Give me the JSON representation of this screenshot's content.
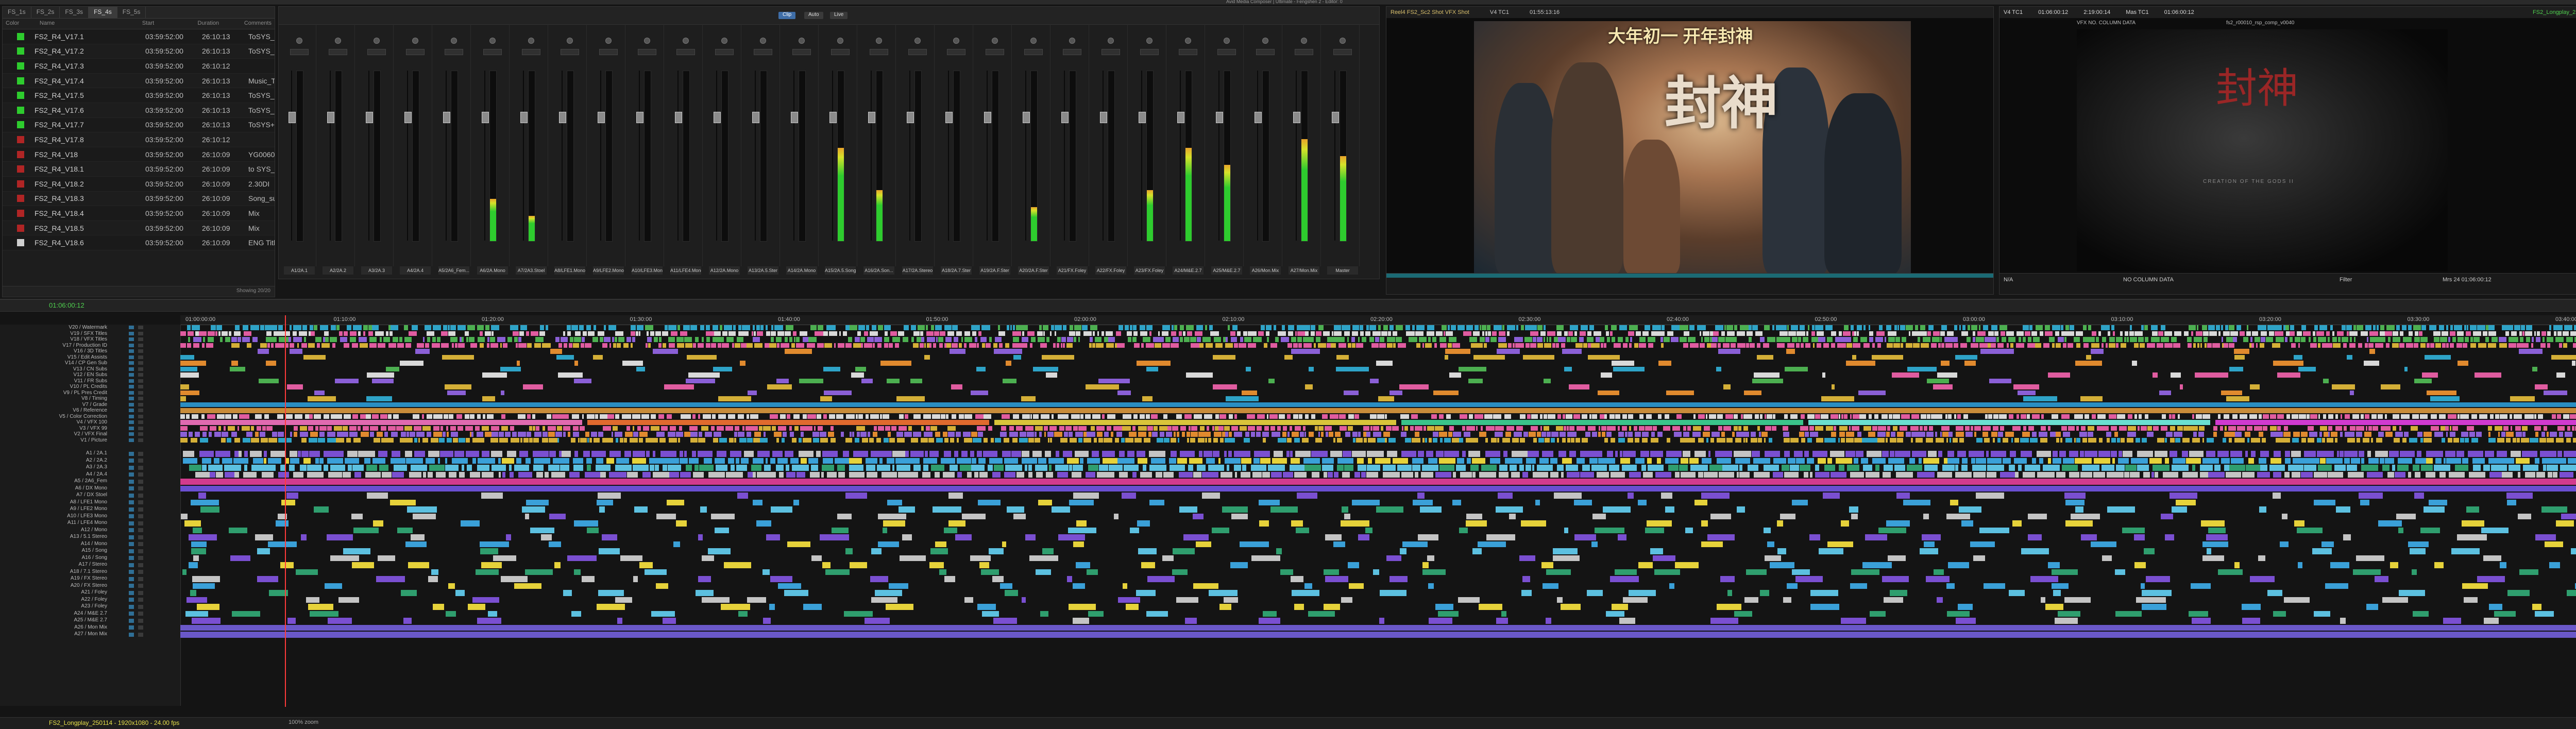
{
  "app": {
    "title": "Avid Media Composer | Ultimate - Fengshen 2 - Editor: 0"
  },
  "bin": {
    "tabs": [
      "FS_1s",
      "FS_2s",
      "FS_3s",
      "FS_4s",
      "FS_5s"
    ],
    "active_tab": 3,
    "columns": [
      "Color",
      "Name",
      "Start",
      "Duration",
      "Comments"
    ],
    "rows": [
      {
        "color": "#2ecc2e",
        "name": "FS2_R4_V17.1",
        "start": "03:59:52:00",
        "duration": "26:10:13",
        "comment": "ToSYS_241202"
      },
      {
        "color": "#2ecc2e",
        "name": "FS2_R4_V17.2",
        "start": "03:59:52:00",
        "duration": "26:10:13",
        "comment": "ToSYS_241208"
      },
      {
        "color": "#2ecc2e",
        "name": "FS2_R4_V17.3",
        "start": "03:59:52:00",
        "duration": "26:10:12",
        "comment": ""
      },
      {
        "color": "#2ecc2e",
        "name": "FS2_R4_V17.4",
        "start": "03:59:52:00",
        "duration": "26:10:13",
        "comment": "Music_ToSYS_241"
      },
      {
        "color": "#2ecc2e",
        "name": "FS2_R4_V17.5",
        "start": "03:59:52:00",
        "duration": "26:10:13",
        "comment": "ToSYS_241223"
      },
      {
        "color": "#2ecc2e",
        "name": "FS2_R4_V17.6",
        "start": "03:59:52:00",
        "duration": "26:10:13",
        "comment": "ToSYS_241225"
      },
      {
        "color": "#2ecc2e",
        "name": "FS2_R4_V17.7",
        "start": "03:59:52:00",
        "duration": "26:10:13",
        "comment": "ToSYS+DI_24125"
      },
      {
        "color": "#b02525",
        "name": "FS2_R4_V17.8",
        "start": "03:59:52:00",
        "duration": "26:10:12",
        "comment": ""
      },
      {
        "color": "#b02525",
        "name": "FS2_R4_V18",
        "start": "03:59:52:00",
        "duration": "26:10:09",
        "comment": "YG0060_ToPost_2"
      },
      {
        "color": "#b02525",
        "name": "FS2_R4_V18.1",
        "start": "03:59:52:00",
        "duration": "26:10:09",
        "comment": "to SYS_250102"
      },
      {
        "color": "#b02525",
        "name": "FS2_R4_V18.2",
        "start": "03:59:52:00",
        "duration": "26:10:09",
        "comment": "2.30DI"
      },
      {
        "color": "#b02525",
        "name": "FS2_R4_V18.3",
        "start": "03:59:52:00",
        "duration": "26:10:09",
        "comment": "Song_subs CNT"
      },
      {
        "color": "#b02525",
        "name": "FS2_R4_V18.4",
        "start": "03:59:52:00",
        "duration": "26:10:09",
        "comment": "Mix"
      },
      {
        "color": "#b02525",
        "name": "FS2_R4_V18.5",
        "start": "03:59:52:00",
        "duration": "26:10:09",
        "comment": "Mix"
      },
      {
        "color": "#cfcfcf",
        "name": "FS2_R4_V18.6",
        "start": "03:59:52:00",
        "duration": "26:10:09",
        "comment": "ENG Titles"
      }
    ],
    "footer": "Showing 20/20"
  },
  "mixer": {
    "buttons": [
      "Clip",
      "Auto",
      "Live"
    ],
    "active_button": 0,
    "strips": [
      {
        "label": "A1/2A.1",
        "level": 0
      },
      {
        "label": "A2/2A.2",
        "level": 0
      },
      {
        "label": "A3/2A.3",
        "level": 0
      },
      {
        "label": "A4/2A.4",
        "level": 0
      },
      {
        "label": "A5/2A6_Fem...",
        "level": 0
      },
      {
        "label": "A6/2A.Mono",
        "level": 0.25
      },
      {
        "label": "A7/2A3.Stoel",
        "level": 0.15
      },
      {
        "label": "A8/LFE1.Mono",
        "level": 0
      },
      {
        "label": "A9/LFE2.Mono",
        "level": 0
      },
      {
        "label": "A10/LFE3.Mono",
        "level": 0
      },
      {
        "label": "A11/LFE4.Mono",
        "level": 0
      },
      {
        "label": "A12/2A.Mono",
        "level": 0
      },
      {
        "label": "A13/2A.5.Ster",
        "level": 0
      },
      {
        "label": "A14/2A.Mono",
        "level": 0
      },
      {
        "label": "A15/2A.5.Song",
        "level": 0.55
      },
      {
        "label": "A16/2A.Son...",
        "level": 0.3
      },
      {
        "label": "A17/2A.Stereo",
        "level": 0
      },
      {
        "label": "A18/2A.7.Ster",
        "level": 0
      },
      {
        "label": "A19/2A.F.Ster",
        "level": 0
      },
      {
        "label": "A20/2A.F.Ster",
        "level": 0.2
      },
      {
        "label": "A21/FX.Foley",
        "level": 0
      },
      {
        "label": "A22/FX.Foley",
        "level": 0
      },
      {
        "label": "A23/FX.Foley",
        "level": 0.3
      },
      {
        "label": "A24/M&E.2.7",
        "level": 0.55
      },
      {
        "label": "A25/M&E.2.7",
        "level": 0.45
      },
      {
        "label": "A26/Mon.Mix",
        "level": 0
      },
      {
        "label": "A27/Mon.Mix",
        "level": 0.6
      },
      {
        "label": "Master",
        "level": 0.5
      }
    ]
  },
  "source_monitor": {
    "clip_name": "Reel4 FS2_Sc2 Shot VFX Shot",
    "timecode_label": "V4 TC1",
    "timecode": "01:55:13:16",
    "poster_title": "大年初一 开年封神",
    "poster_glyph": "封神"
  },
  "record_monitor": {
    "tc_label": "V4 TC1",
    "timecode": "01:06:00:12",
    "duration": "2:19:00:14",
    "mas_label": "Mas TC1",
    "mas_timecode": "01:06:00:12",
    "sequence": "FS2_Longplay_250114",
    "vfx_label": "VFX NO. COLUMN DATA",
    "shot_name": "fs2_r00010_rsp_comp_v0040",
    "glyph": "封神",
    "subtitle": "CREATION OF THE GODS II",
    "bottom_left": "N/A",
    "bottom_mid": "NO COLUMN DATA",
    "bottom_filter": "Filter",
    "bottom_right": "Mrs 24  01:06:00:12"
  },
  "timeline": {
    "timecode": "01:06:00:12",
    "ruler": [
      "01:00:00:00",
      "01:10:00",
      "01:20:00",
      "01:30:00",
      "01:40:00",
      "01:50:00",
      "02:00:00",
      "02:10:00",
      "02:20:00",
      "02:30:00",
      "02:40:00",
      "02:50:00",
      "03:00:00",
      "03:10:00",
      "03:20:00",
      "03:30:00",
      "03:40:00"
    ],
    "video_tracks": [
      "V20 / Watermark",
      "V19 / SFX Titles",
      "V18 / VFX Titles",
      "V17 / Production ID",
      "V16 / 3D Titles",
      "V15 / Edit Assists",
      "V14 / CP Gen Sub",
      "V13 / CN Subs",
      "V12 / EN Subs",
      "V11 / FR Subs",
      "V10 / PL Credits",
      "V9 / PL Pres Credit",
      "V8 / Timing",
      "V7 / Grade",
      "V6 / Reference",
      "V5 / Color Correction",
      "V4 / VFX 100",
      "V3 / VFX 99",
      "V2 / VFX Final",
      "V1 / Picture"
    ],
    "audio_tracks": [
      "A1 / 2A.1",
      "A2 / 2A.2",
      "A3 / 2A.3",
      "A4 / 2A.4",
      "A5 / 2A6_Fem",
      "A6 / DX Mono",
      "A7 / DX Stoel",
      "A8 / LFE1 Mono",
      "A9 / LFE2 Mono",
      "A10 / LFE3 Mono",
      "A11 / LFE4 Mono",
      "A12 / Mono",
      "A13 / 5.1 Stereo",
      "A14 / Mono",
      "A15 / Song",
      "A16 / Song",
      "A17 / Stereo",
      "A18 / 7.1 Stereo",
      "A19 / FX Stereo",
      "A20 / FX Stereo",
      "A21 / Foley",
      "A22 / Foley",
      "A23 / Foley",
      "A24 / M&E 2.7",
      "A25 / M&E 2.7",
      "A26 / Mon Mix",
      "A27 / Mon Mix"
    ],
    "sequence_name": "FS2_Longplay_250114 - 1920x1080 - 24.00 fps",
    "zoom_label": "100% zoom"
  }
}
